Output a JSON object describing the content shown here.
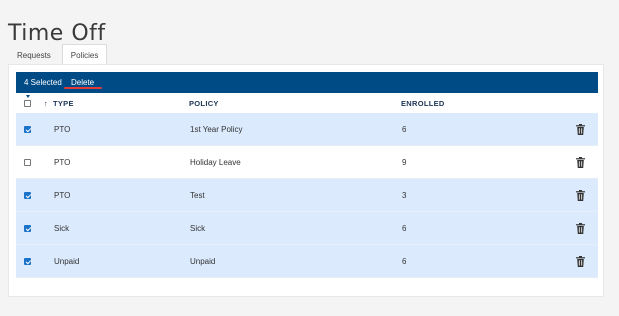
{
  "page": {
    "title": "Time Off"
  },
  "tabs": [
    {
      "label": "Requests",
      "active": false
    },
    {
      "label": "Policies",
      "active": true
    }
  ],
  "bulk_actions": {
    "selected_label": "4 Selected",
    "delete_label": "Delete"
  },
  "table": {
    "columns": {
      "type": "TYPE",
      "policy": "POLICY",
      "enrolled": "ENROLLED"
    },
    "sort_icon": "arrow-up-icon",
    "row_icon": "trash-icon",
    "rows": [
      {
        "type": "PTO",
        "policy": "1st Year Policy",
        "enrolled": "6",
        "selected": true
      },
      {
        "type": "PTO",
        "policy": "Holiday Leave",
        "enrolled": "9",
        "selected": false
      },
      {
        "type": "PTO",
        "policy": "Test",
        "enrolled": "3",
        "selected": true
      },
      {
        "type": "Sick",
        "policy": "Sick",
        "enrolled": "6",
        "selected": true
      },
      {
        "type": "Unpaid",
        "policy": "Unpaid",
        "enrolled": "6",
        "selected": true
      }
    ]
  },
  "colors": {
    "bulkbar": "#004b86",
    "selected_row": "#dbeafd",
    "checkbox_checked": "#1a73c8",
    "delete_underline": "#e03a3a"
  }
}
